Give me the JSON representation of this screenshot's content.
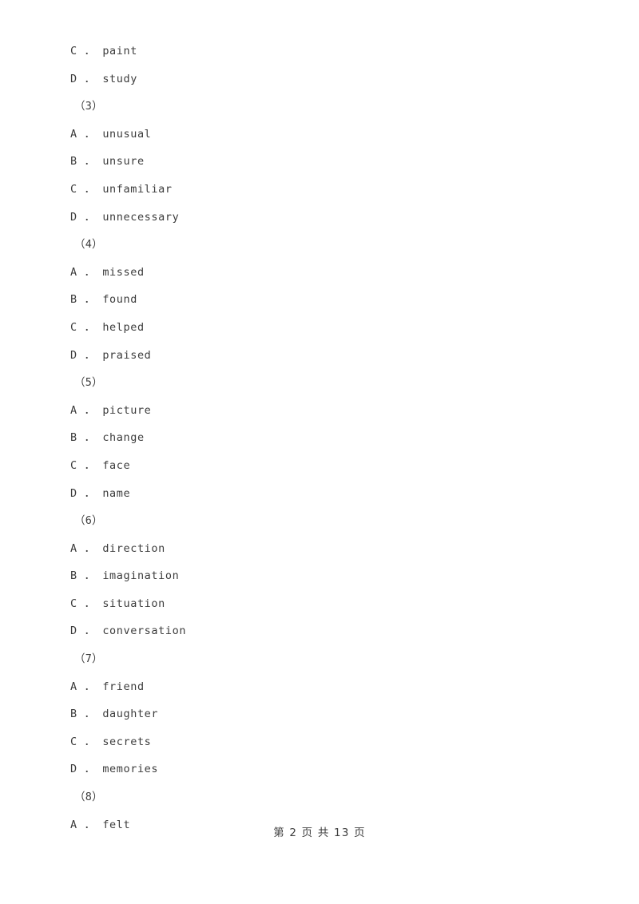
{
  "page": {
    "background_color": "#ffffff",
    "text_color": "#3c3c3c"
  },
  "footer": {
    "text": "第 2 页 共 13 页",
    "page_number": 2,
    "total_pages": 13
  },
  "lines": [
    {
      "kind": "option",
      "letter": "C",
      "separator": "．",
      "text": "paint"
    },
    {
      "kind": "option",
      "letter": "D",
      "separator": "．",
      "text": "study"
    },
    {
      "kind": "qnum",
      "text": "（3）"
    },
    {
      "kind": "option",
      "letter": "A",
      "separator": "．",
      "text": "unusual"
    },
    {
      "kind": "option",
      "letter": "B",
      "separator": "．",
      "text": "unsure"
    },
    {
      "kind": "option",
      "letter": "C",
      "separator": "．",
      "text": "unfamiliar"
    },
    {
      "kind": "option",
      "letter": "D",
      "separator": "．",
      "text": "unnecessary"
    },
    {
      "kind": "qnum",
      "text": "（4）"
    },
    {
      "kind": "option",
      "letter": "A",
      "separator": "．",
      "text": "missed"
    },
    {
      "kind": "option",
      "letter": "B",
      "separator": "．",
      "text": "found"
    },
    {
      "kind": "option",
      "letter": "C",
      "separator": "．",
      "text": "helped"
    },
    {
      "kind": "option",
      "letter": "D",
      "separator": "．",
      "text": "praised"
    },
    {
      "kind": "qnum",
      "text": "（5）"
    },
    {
      "kind": "option",
      "letter": "A",
      "separator": "．",
      "text": "picture"
    },
    {
      "kind": "option",
      "letter": "B",
      "separator": "．",
      "text": "change"
    },
    {
      "kind": "option",
      "letter": "C",
      "separator": "．",
      "text": "face"
    },
    {
      "kind": "option",
      "letter": "D",
      "separator": "．",
      "text": "name"
    },
    {
      "kind": "qnum",
      "text": "（6）"
    },
    {
      "kind": "option",
      "letter": "A",
      "separator": "．",
      "text": "direction"
    },
    {
      "kind": "option",
      "letter": "B",
      "separator": "．",
      "text": "imagination"
    },
    {
      "kind": "option",
      "letter": "C",
      "separator": "．",
      "text": "situation"
    },
    {
      "kind": "option",
      "letter": "D",
      "separator": "．",
      "text": "conversation"
    },
    {
      "kind": "qnum",
      "text": "（7）"
    },
    {
      "kind": "option",
      "letter": "A",
      "separator": "．",
      "text": "friend"
    },
    {
      "kind": "option",
      "letter": "B",
      "separator": "．",
      "text": "daughter"
    },
    {
      "kind": "option",
      "letter": "C",
      "separator": "．",
      "text": "secrets"
    },
    {
      "kind": "option",
      "letter": "D",
      "separator": "．",
      "text": "memories"
    },
    {
      "kind": "qnum",
      "text": "（8）"
    },
    {
      "kind": "option",
      "letter": "A",
      "separator": "．",
      "text": "felt"
    }
  ]
}
